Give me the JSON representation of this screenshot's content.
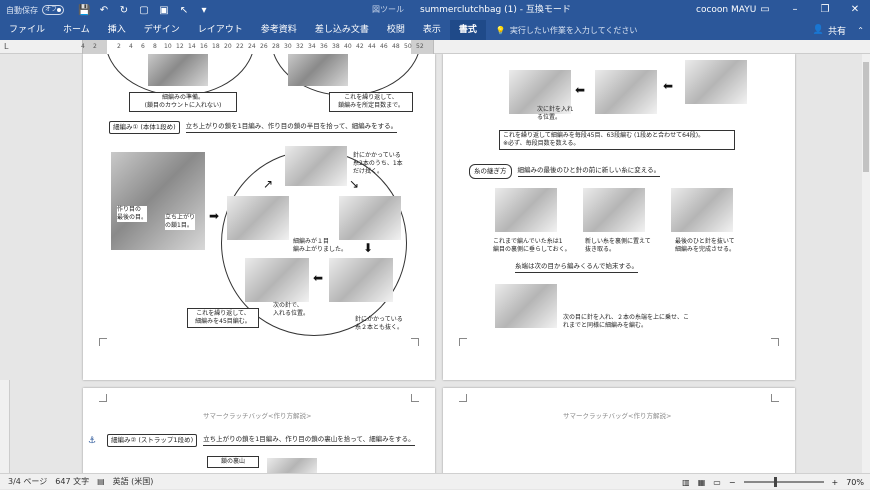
{
  "titlebar": {
    "autosave_label": "自動保存",
    "autosave_state": "オフ",
    "context_tab": "図ツール",
    "doc_title": "summerclutchbag (1)  -  互換モード",
    "user": "cocoon MAYU"
  },
  "ribbon": {
    "tabs": [
      "ファイル",
      "ホーム",
      "挿入",
      "デザイン",
      "レイアウト",
      "参考資料",
      "差し込み文書",
      "校閲",
      "表示",
      "書式"
    ],
    "active_tab": "書式",
    "tellme": "実行したい作業を入力してください",
    "share": "共有"
  },
  "ruler": {
    "ticks": [
      "4",
      "2",
      "",
      "2",
      "4",
      "6",
      "8",
      "10",
      "12",
      "14",
      "16",
      "18",
      "20",
      "22",
      "24",
      "26",
      "28",
      "30",
      "32",
      "34",
      "36",
      "38",
      "40",
      "42",
      "44",
      "46",
      "48",
      "50",
      "52"
    ]
  },
  "page1": {
    "cap_prep": "細編みの準備。\n(鎖目のカウントに入れない)",
    "cap_repeat_top": "これを繰り返して、\n鎖編みを所定目数まで。",
    "heading_tag": "細編み① (本体1段め)",
    "heading_text": "立ち上がりの鎖を1目編み、作り目の鎖の半目を拾って、細編みをする。",
    "lbl_start": "作り目の\n最後の目。",
    "lbl_rise": "立ち上がり\nの鎖1目。",
    "lbl_hook_top": "針にかかっている\n糸2本のうち、1本\nだけ拭く。",
    "lbl_one": "細編みが１目\n編み上がりました。",
    "lbl_next": "次の針で、\n入れる位置。",
    "lbl_pull": "針にかかっている\n糸２本とも抜く。",
    "cap_45": "これを繰り返して、\n細編みを45目編む。"
  },
  "page2": {
    "lbl_next_pos": "次に針を入れ\nる位置。",
    "cap_rows": "これを繰り返して細編みを毎段45目、63段編む (1段めと合わせて64段)。\n※必ず、毎段目数を数える。",
    "join_tag": "糸の継ぎ方",
    "join_text": "細編みの最後のひと針の前に新しい糸に変える。",
    "lbl_a": "これまで編んでいた糸は1\n編目の裏側に垂らしておく。",
    "lbl_b": "新しい糸を裏側に置えて\n抜き取る。",
    "lbl_c": "最後のひと針を抜いて\n細編みを完成させる。",
    "end_note": "糸端は次の目から編みくるんで始末する。",
    "lbl_d": "次の目に針を入れ、２本の糸端を上に乗せ、こ\nれまでと同様に細編みを編む。"
  },
  "page3": {
    "header": "サマークラッチバッグ<作り方解説>",
    "heading_tag": "細編み② (ストラップ1段め)",
    "heading_text": "立ち上がりの鎖を1目編み、作り目の鎖の裏山を拾って、細編みをする。",
    "box": "鎖の裏山"
  },
  "page4": {
    "header": "サマークラッチバッグ<作り方解説>"
  },
  "statusbar": {
    "page": "3/4 ページ",
    "words": "647 文字",
    "language": "英語 (米国)",
    "zoom": "70%"
  }
}
